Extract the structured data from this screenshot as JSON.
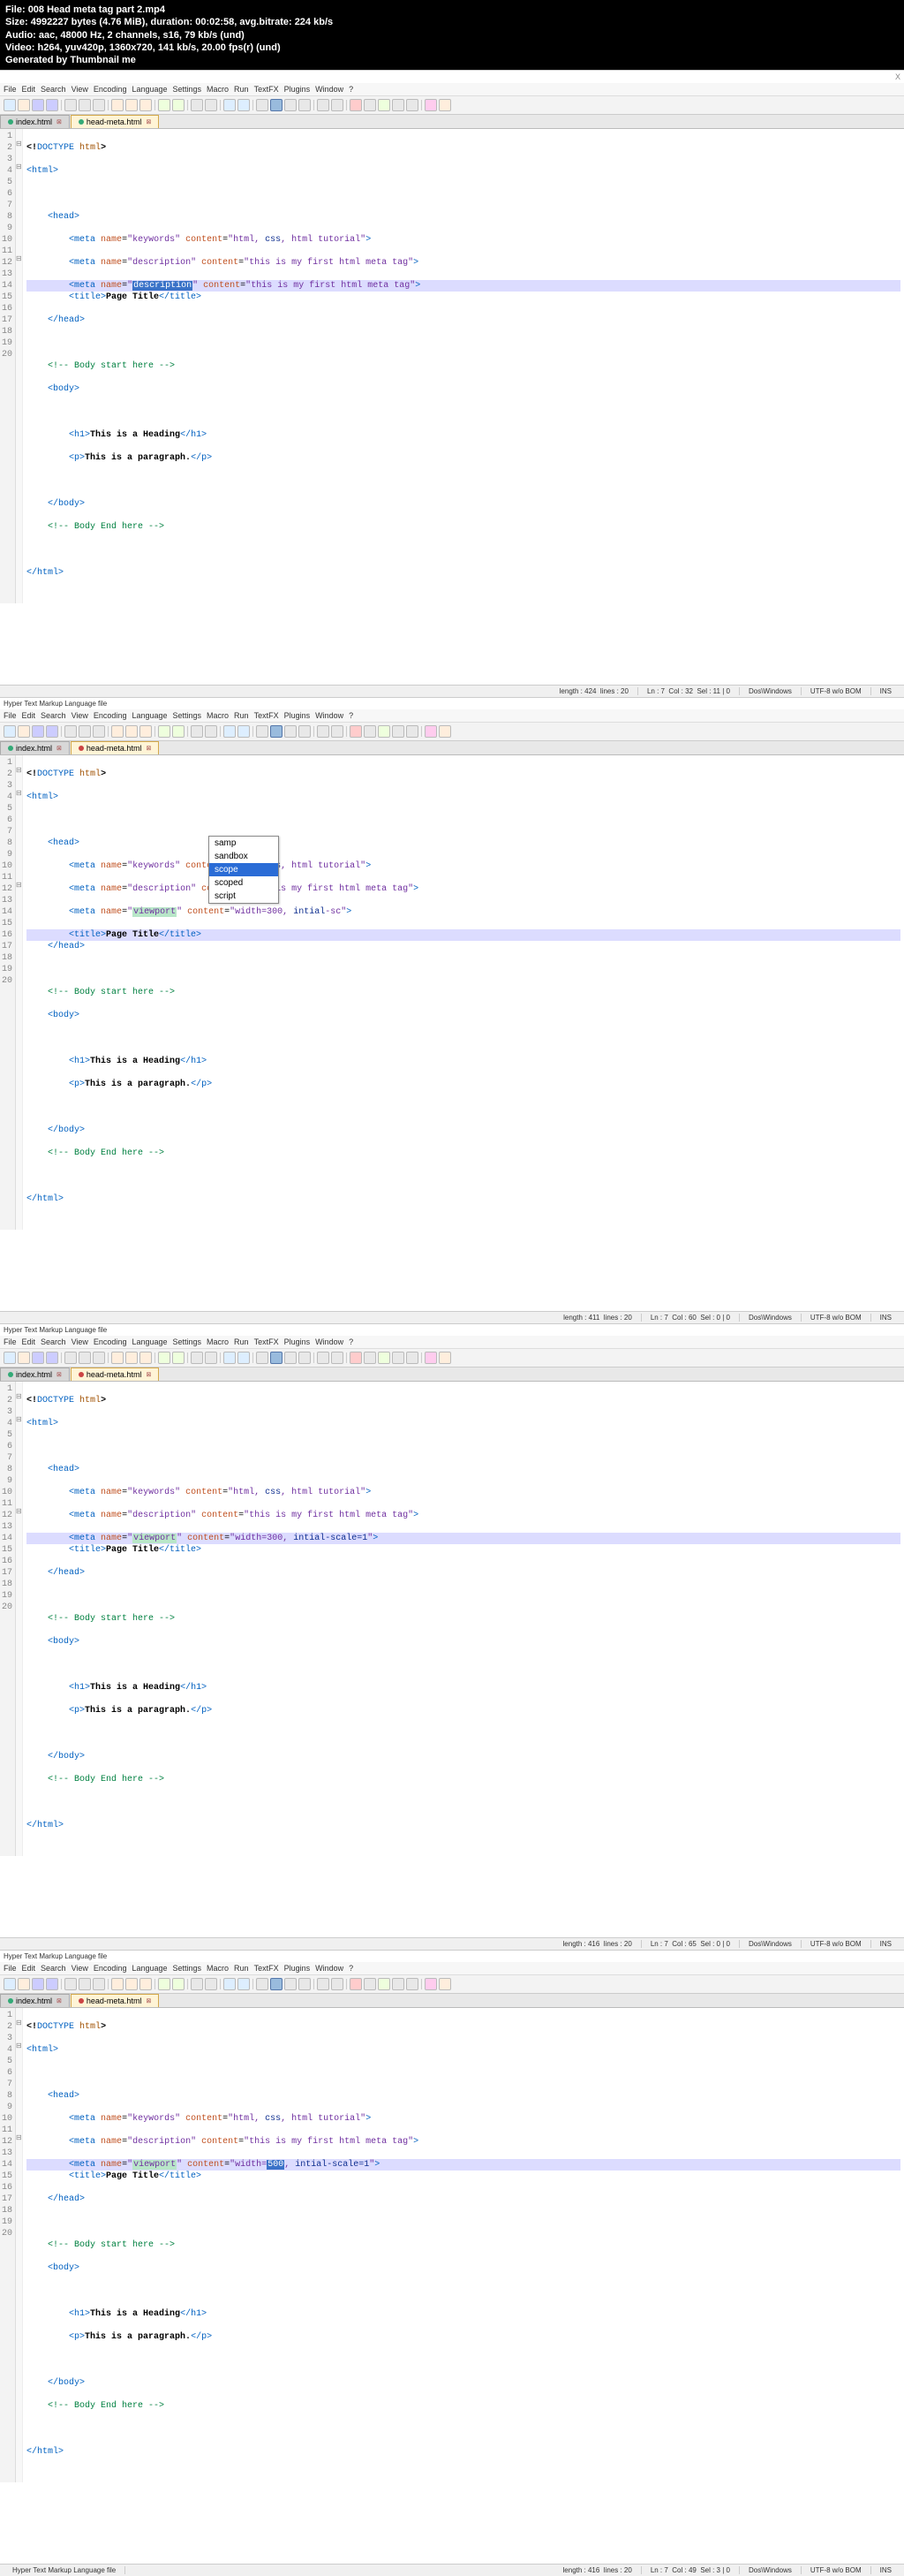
{
  "header": {
    "file_lbl": "File:",
    "file_val": "008 Head meta tag part 2.mp4",
    "size_lbl": "Size:",
    "size_val": "4992227 bytes (4.76 MiB), duration: 00:02:58, avg.bitrate: 224 kb/s",
    "audio_lbl": "Audio:",
    "audio_val": "aac, 48000 Hz, 2 channels, s16, 79 kb/s (und)",
    "video_lbl": "Video:",
    "video_val": "h264, yuv420p, 1360x720, 141 kb/s, 20.00 fps(r) (und)",
    "gen": "Generated by Thumbnail me"
  },
  "menu": [
    "File",
    "Edit",
    "Search",
    "View",
    "Encoding",
    "Language",
    "Settings",
    "Macro",
    "Run",
    "TextFX",
    "Plugins",
    "Window",
    "?"
  ],
  "tabs": {
    "t1": "index.html",
    "t2": "head-meta.html"
  },
  "title": "Hyper Text Markup Language file",
  "autocomplete": {
    "items": [
      "samp",
      "sandbox",
      "scope",
      "scoped",
      "script"
    ],
    "selected_index": 2
  },
  "code_common": {
    "doctype": "<!DOCTYPE html>",
    "html_open": "<html>",
    "html_close": "</html>",
    "head_open": "<head>",
    "head_close": "</head>",
    "body_open": "<body>",
    "body_close": "</body>",
    "meta1_a": "meta",
    "meta1_n": "name",
    "meta1_nv": "keywords",
    "meta1_c": "content",
    "meta1_cv": "html, css, html tutorial",
    "meta2_nv": "description",
    "meta2_cv": "this is my first html meta tag",
    "title_tag": "title",
    "title_txt": "Page Title",
    "cmt1": "<!-- Body start here -->",
    "cmt2": "<!-- Body End here -->",
    "h1": "h1",
    "h1_txt": "This is a Heading",
    "p": "p",
    "p_txt": "This is a paragraph."
  },
  "panel1": {
    "line7_nv": "description",
    "line7_cv": "this is my first html meta tag",
    "status": {
      "len": "length : 424",
      "lines": "lines : 20",
      "ln": "Ln : 7",
      "col": "Col : 32",
      "sel": "Sel : 11 | 0",
      "eol": "Dos\\Windows",
      "enc": "UTF-8 w/o BOM",
      "ins": "INS"
    }
  },
  "panel2": {
    "line7_nv": "viewport",
    "line7_cv": "width=300, intial-sc",
    "status": {
      "len": "length : 411",
      "lines": "lines : 20",
      "ln": "Ln : 7",
      "col": "Col : 60",
      "sel": "Sel : 0 | 0",
      "eol": "Dos\\Windows",
      "enc": "UTF-8 w/o BOM",
      "ins": "INS"
    }
  },
  "panel3": {
    "line7_nv": "viewport",
    "line7_cv_a": "width=300, ",
    "line7_cv_b": "intial-scale=1",
    "status": {
      "len": "length : 416",
      "lines": "lines : 20",
      "ln": "Ln : 7",
      "col": "Col : 65",
      "sel": "Sel : 0 | 0",
      "eol": "Dos\\Windows",
      "enc": "UTF-8 w/o BOM",
      "ins": "INS"
    }
  },
  "panel4": {
    "line7_nv": "viewport",
    "line7_cv": "width=500, intial-scale=1",
    "status": {
      "len": "length : 416",
      "lines": "lines : 20",
      "ln": "Ln : 7",
      "col": "Col : 49",
      "sel": "Sel : 3 | 0",
      "eol": "Dos\\Windows",
      "enc": "UTF-8 w/o BOM",
      "ins": "INS"
    }
  }
}
